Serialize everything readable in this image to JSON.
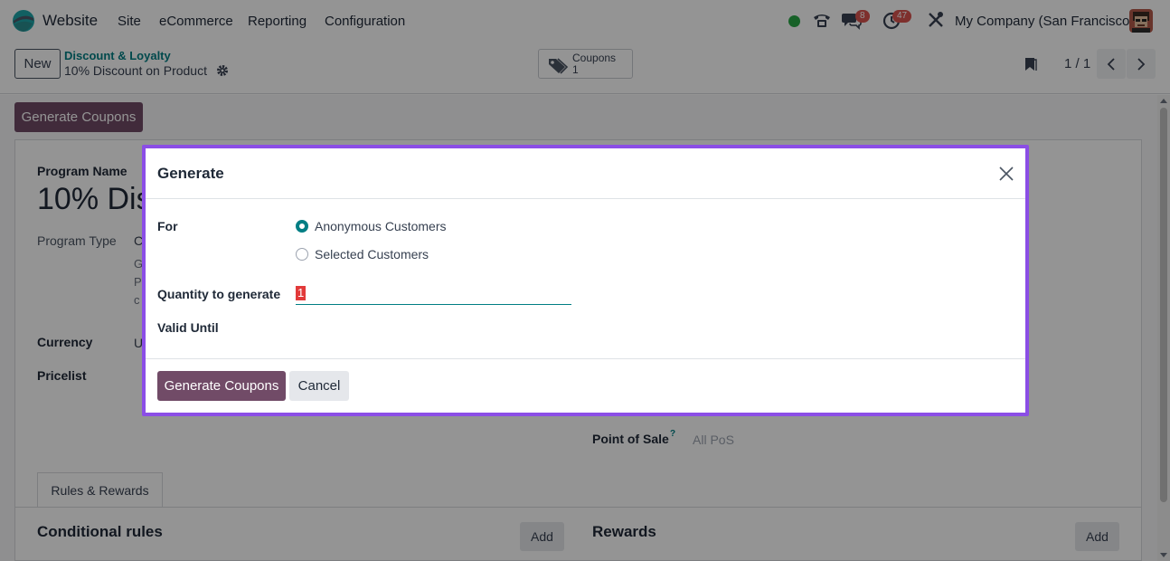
{
  "navbar": {
    "app_name": "Website",
    "menu": [
      "Site",
      "eCommerce",
      "Reporting",
      "Configuration"
    ],
    "messages_badge": "8",
    "activities_badge": "47",
    "company": "My Company (San Francisco)"
  },
  "control_panel": {
    "new_label": "New",
    "breadcrumb_parent": "Discount & Loyalty",
    "breadcrumb_current": "10% Discount on Product",
    "smart_button": {
      "label": "Coupons",
      "count": "1"
    },
    "pager": "1 / 1"
  },
  "form": {
    "generate_button": "Generate Coupons",
    "program_name_label": "Program Name",
    "program_name_value": "10% Dis",
    "program_type_label": "Program Type",
    "program_type_value": "C",
    "program_type_desc": [
      "G",
      "P",
      "c"
    ],
    "currency_label": "Currency",
    "currency_value": "U",
    "pricelist_label": "Pricelist",
    "pos_label": "Point of Sale",
    "pos_help": "?",
    "pos_value": "All PoS",
    "tab_label": "Rules & Rewards",
    "conditional_rules": "Conditional rules",
    "rewards": "Rewards",
    "add_label": "Add"
  },
  "dialog": {
    "title": "Generate",
    "for_label": "For",
    "options": [
      "Anonymous Customers",
      "Selected Customers"
    ],
    "selected_option": "Anonymous Customers",
    "quantity_label": "Quantity to generate",
    "quantity_value": "1",
    "valid_until_label": "Valid Until",
    "primary_button": "Generate Coupons",
    "cancel_button": "Cancel"
  },
  "colors": {
    "primary": "#714b67",
    "teal": "#017e84",
    "dialog_border": "#8b4ee6"
  }
}
